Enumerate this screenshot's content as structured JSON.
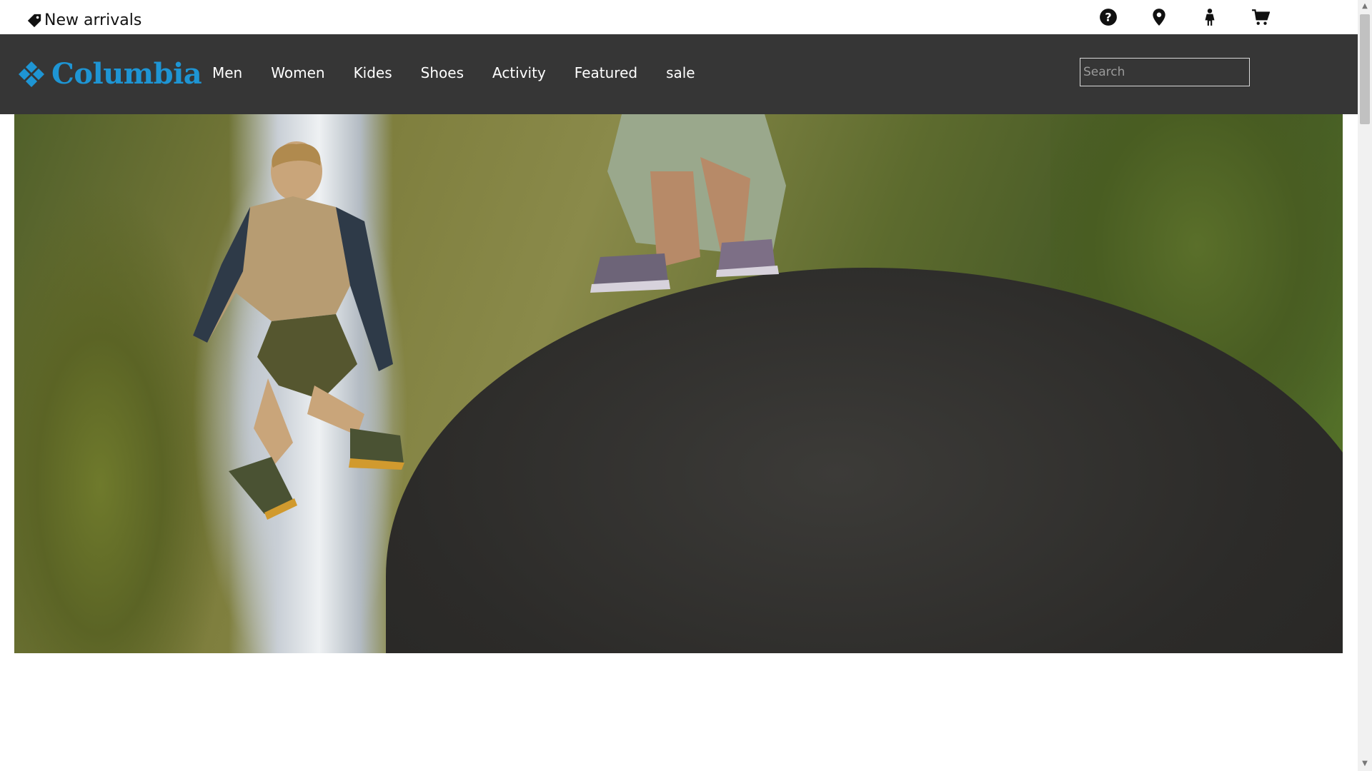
{
  "topbar": {
    "promo_text": "New arrivals",
    "icons": [
      "help-icon",
      "location-pin-icon",
      "person-icon",
      "cart-icon"
    ]
  },
  "nav": {
    "logo_text": "Columbia",
    "links": [
      "Men",
      "Women",
      "Kides",
      "Shoes",
      "Activity",
      "Featured",
      "sale"
    ],
    "search_placeholder": "Search"
  },
  "colors": {
    "navbar_bg": "#363636",
    "brand_blue": "#1e95d4",
    "link_text": "#ffffff"
  }
}
